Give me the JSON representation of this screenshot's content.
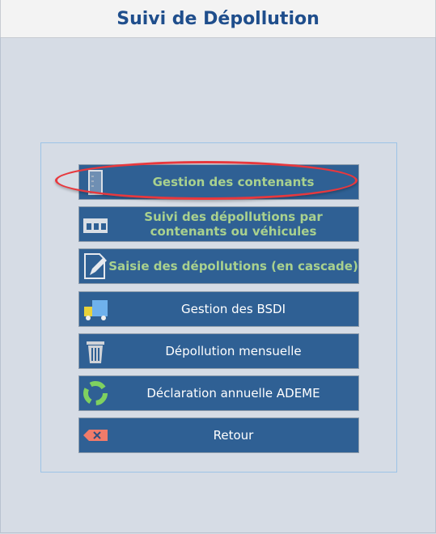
{
  "header": {
    "title": "Suivi de Dépollution"
  },
  "menu": [
    {
      "label": "Gestion des contenants",
      "icon": "container-icon"
    },
    {
      "label": "Suivi des dépollutions par contenants ou véhicules",
      "icon": "containers-tracking-icon"
    },
    {
      "label": "Saisie des dépollutions (en cascade)",
      "icon": "edit-document-icon"
    },
    {
      "label": "Gestion des BSDI",
      "icon": "truck-icon"
    },
    {
      "label": "Dépollution mensuelle",
      "icon": "trash-icon"
    },
    {
      "label": "Déclaration annuelle ADEME",
      "icon": "recycle-icon"
    },
    {
      "label": "Retour",
      "icon": "backspace-icon"
    }
  ],
  "colors": {
    "button": "#2f6094",
    "highlight": "#e8383d",
    "green_text": "#a9d18e",
    "title": "#1f4e8c"
  }
}
